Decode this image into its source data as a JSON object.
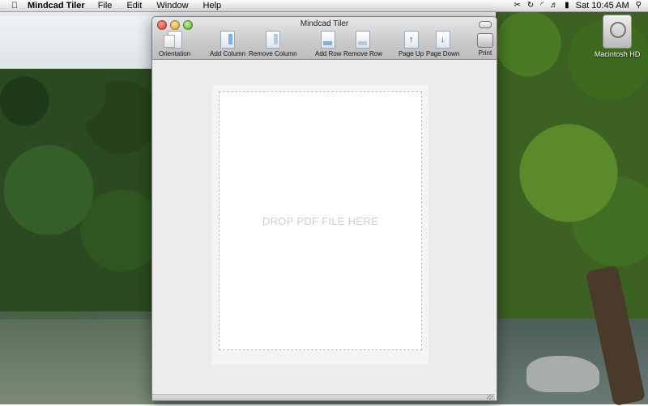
{
  "menubar": {
    "apple_icon": "apple-logo-icon",
    "app_name": "Mindcad Tiler",
    "menus": [
      "File",
      "Edit",
      "Window",
      "Help"
    ],
    "status_icons": [
      "scissors-icon",
      "sync-icon",
      "wifi-icon",
      "volume-icon",
      "battery-icon"
    ],
    "clock": "Sat 10:45 AM",
    "spotlight_icon": "spotlight-icon"
  },
  "desktop": {
    "hd_label": "Macintosh HD"
  },
  "window": {
    "title": "Mindcad Tiler",
    "toolbar": {
      "orientation": "Orientation",
      "add_column": "Add Column",
      "remove_column": "Remove Column",
      "add_row": "Add Row",
      "remove_row": "Remove Row",
      "page_up": "Page Up",
      "page_down": "Page Down",
      "print": "Print"
    },
    "drop_zone_text": "DROP PDF FILE HERE"
  }
}
